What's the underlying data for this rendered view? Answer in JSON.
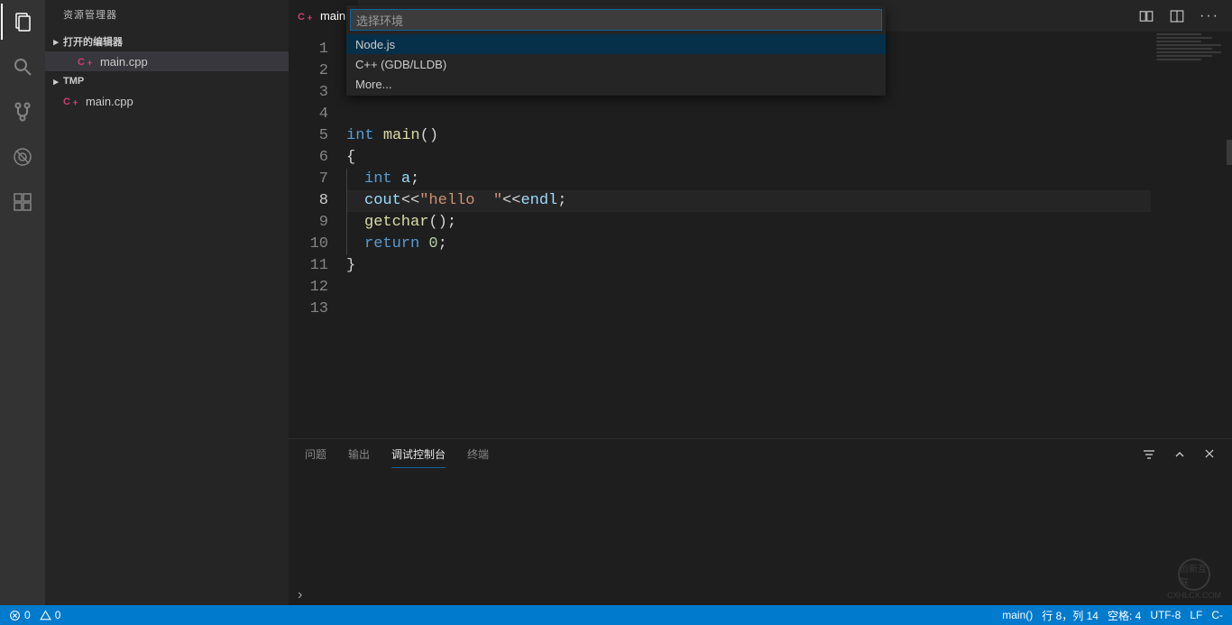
{
  "sidebar": {
    "title": "资源管理器",
    "open_editors_label": "打开的编辑器",
    "workspace_label": "TMP",
    "open_editors": [
      {
        "name": "main.cpp"
      }
    ],
    "files": [
      {
        "name": "main.cpp"
      }
    ]
  },
  "tab": {
    "filename": "main."
  },
  "quickpick": {
    "placeholder": "选择环境",
    "items": [
      "Node.js",
      "C++ (GDB/LLDB)",
      "More..."
    ]
  },
  "code": {
    "lines_count": 13,
    "current_line": 8,
    "tokens": [
      [],
      [],
      [],
      [],
      [
        {
          "t": "int",
          "c": "kw"
        },
        {
          "t": " "
        },
        {
          "t": "main",
          "c": "fn"
        },
        {
          "t": "()",
          "c": "op"
        }
      ],
      [
        {
          "t": "{",
          "c": "op"
        }
      ],
      [
        {
          "indent": 1
        },
        {
          "t": "int",
          "c": "kw"
        },
        {
          "t": " "
        },
        {
          "t": "a",
          "c": "id"
        },
        {
          "t": ";",
          "c": "op"
        }
      ],
      [
        {
          "indent": 1
        },
        {
          "t": "cout",
          "c": "id"
        },
        {
          "t": "<<",
          "c": "op"
        },
        {
          "t": "\"hello  \"",
          "c": "str"
        },
        {
          "t": "<<",
          "c": "op"
        },
        {
          "t": "endl",
          "c": "id"
        },
        {
          "t": ";",
          "c": "op"
        }
      ],
      [
        {
          "indent": 1
        },
        {
          "t": "getchar",
          "c": "fn"
        },
        {
          "t": "();",
          "c": "op"
        }
      ],
      [
        {
          "indent": 1
        },
        {
          "t": "return",
          "c": "kw"
        },
        {
          "t": " "
        },
        {
          "t": "0",
          "c": "num"
        },
        {
          "t": ";",
          "c": "op"
        }
      ],
      [
        {
          "t": "}",
          "c": "op"
        }
      ],
      [],
      []
    ]
  },
  "panel": {
    "tabs": {
      "problems": "问题",
      "output": "输出",
      "debug_console": "调试控制台",
      "terminal": "终端"
    },
    "active": "debug_console"
  },
  "breadcrumb": "›",
  "status": {
    "errors": "0",
    "warnings": "0",
    "symbol": "main()",
    "position": "行 8，列 14",
    "spaces": "空格: 4",
    "encoding": "UTF-8",
    "eol": "LF",
    "lang_short": "C-"
  },
  "watermark": {
    "text": "创新互联",
    "sub": "CXHLCX.COM"
  }
}
